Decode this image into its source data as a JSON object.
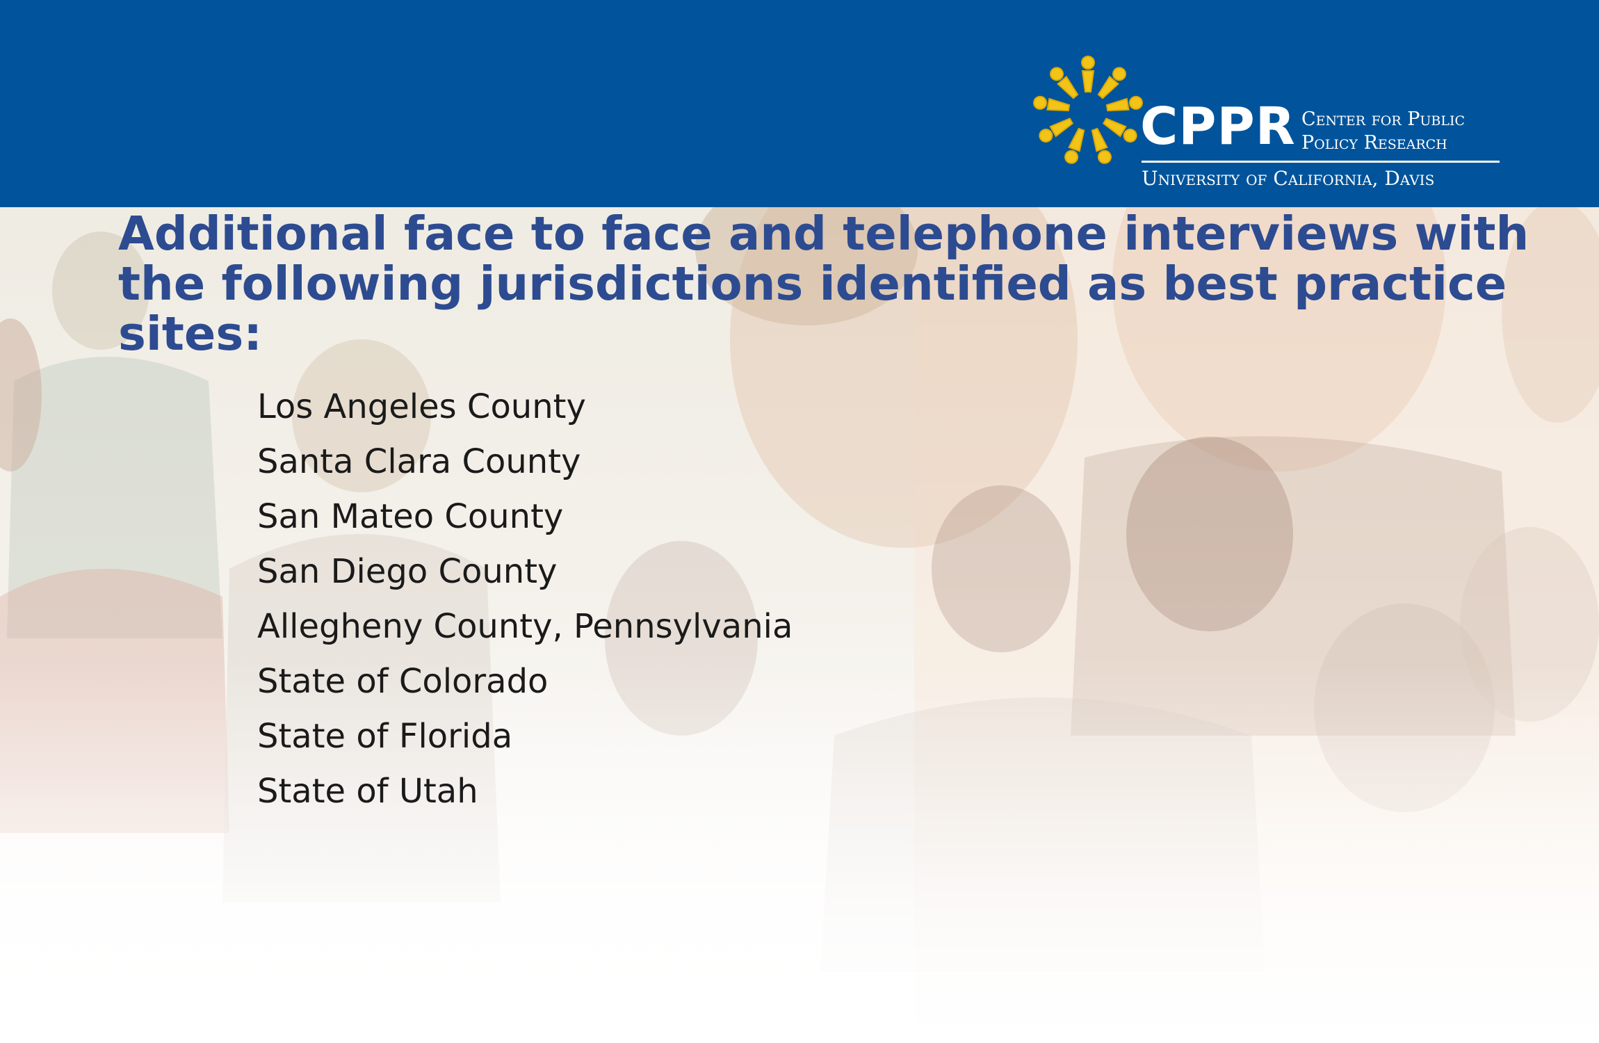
{
  "logo": {
    "name": "CPPR",
    "line1": "Center for Public",
    "line2": "Policy Research",
    "university": "University of California, Davis",
    "star_color": "#f2c417"
  },
  "slide": {
    "title": "Additional face to face and telephone interviews with the following jurisdictions identified as best practice sites:",
    "items": [
      "Los Angeles County",
      "Santa Clara County",
      "San Mateo County",
      "San Diego County",
      "Allegheny County, Pennsylvania",
      "State of Colorado",
      "State of Florida",
      "State of Utah"
    ]
  },
  "colors": {
    "header_band": "#01549b",
    "title": "#2d4b90",
    "body_text": "#1a1a1a"
  }
}
